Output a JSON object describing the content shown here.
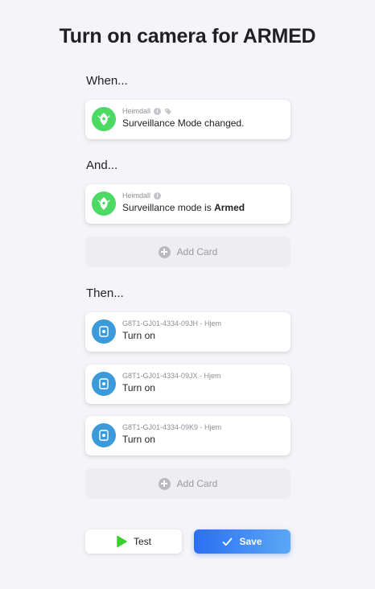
{
  "title": "Turn on camera for ARMED",
  "sections": {
    "when": "When...",
    "and": "And...",
    "then": "Then..."
  },
  "when_card": {
    "owner": "Heimdall",
    "text": "Surveillance Mode changed.",
    "icon": "heimdall-app-icon",
    "color": "#4cd964"
  },
  "and_card": {
    "owner": "Heimdall",
    "text_prefix": "Surveillance mode is ",
    "text_value": "Armed",
    "icon": "heimdall-app-icon",
    "color": "#4cd964"
  },
  "add_card_label": "Add Card",
  "then_cards": [
    {
      "owner": "G8T1-GJ01-4334-09JH - Hjem",
      "text": "Turn on",
      "icon": "camera-device-icon",
      "color": "#3b9ad9"
    },
    {
      "owner": "G8T1-GJ01-4334-09JX - Hjem",
      "text": "Turn on",
      "icon": "camera-device-icon",
      "color": "#3b9ad9"
    },
    {
      "owner": "G8T1-GJ01-4334-09K9 - Hjem",
      "text": "Turn on",
      "icon": "camera-device-icon",
      "color": "#3b9ad9"
    }
  ],
  "buttons": {
    "test": "Test",
    "save": "Save"
  },
  "colors": {
    "accent": "#2a6ff3",
    "test_play": "#3ccf2e"
  }
}
